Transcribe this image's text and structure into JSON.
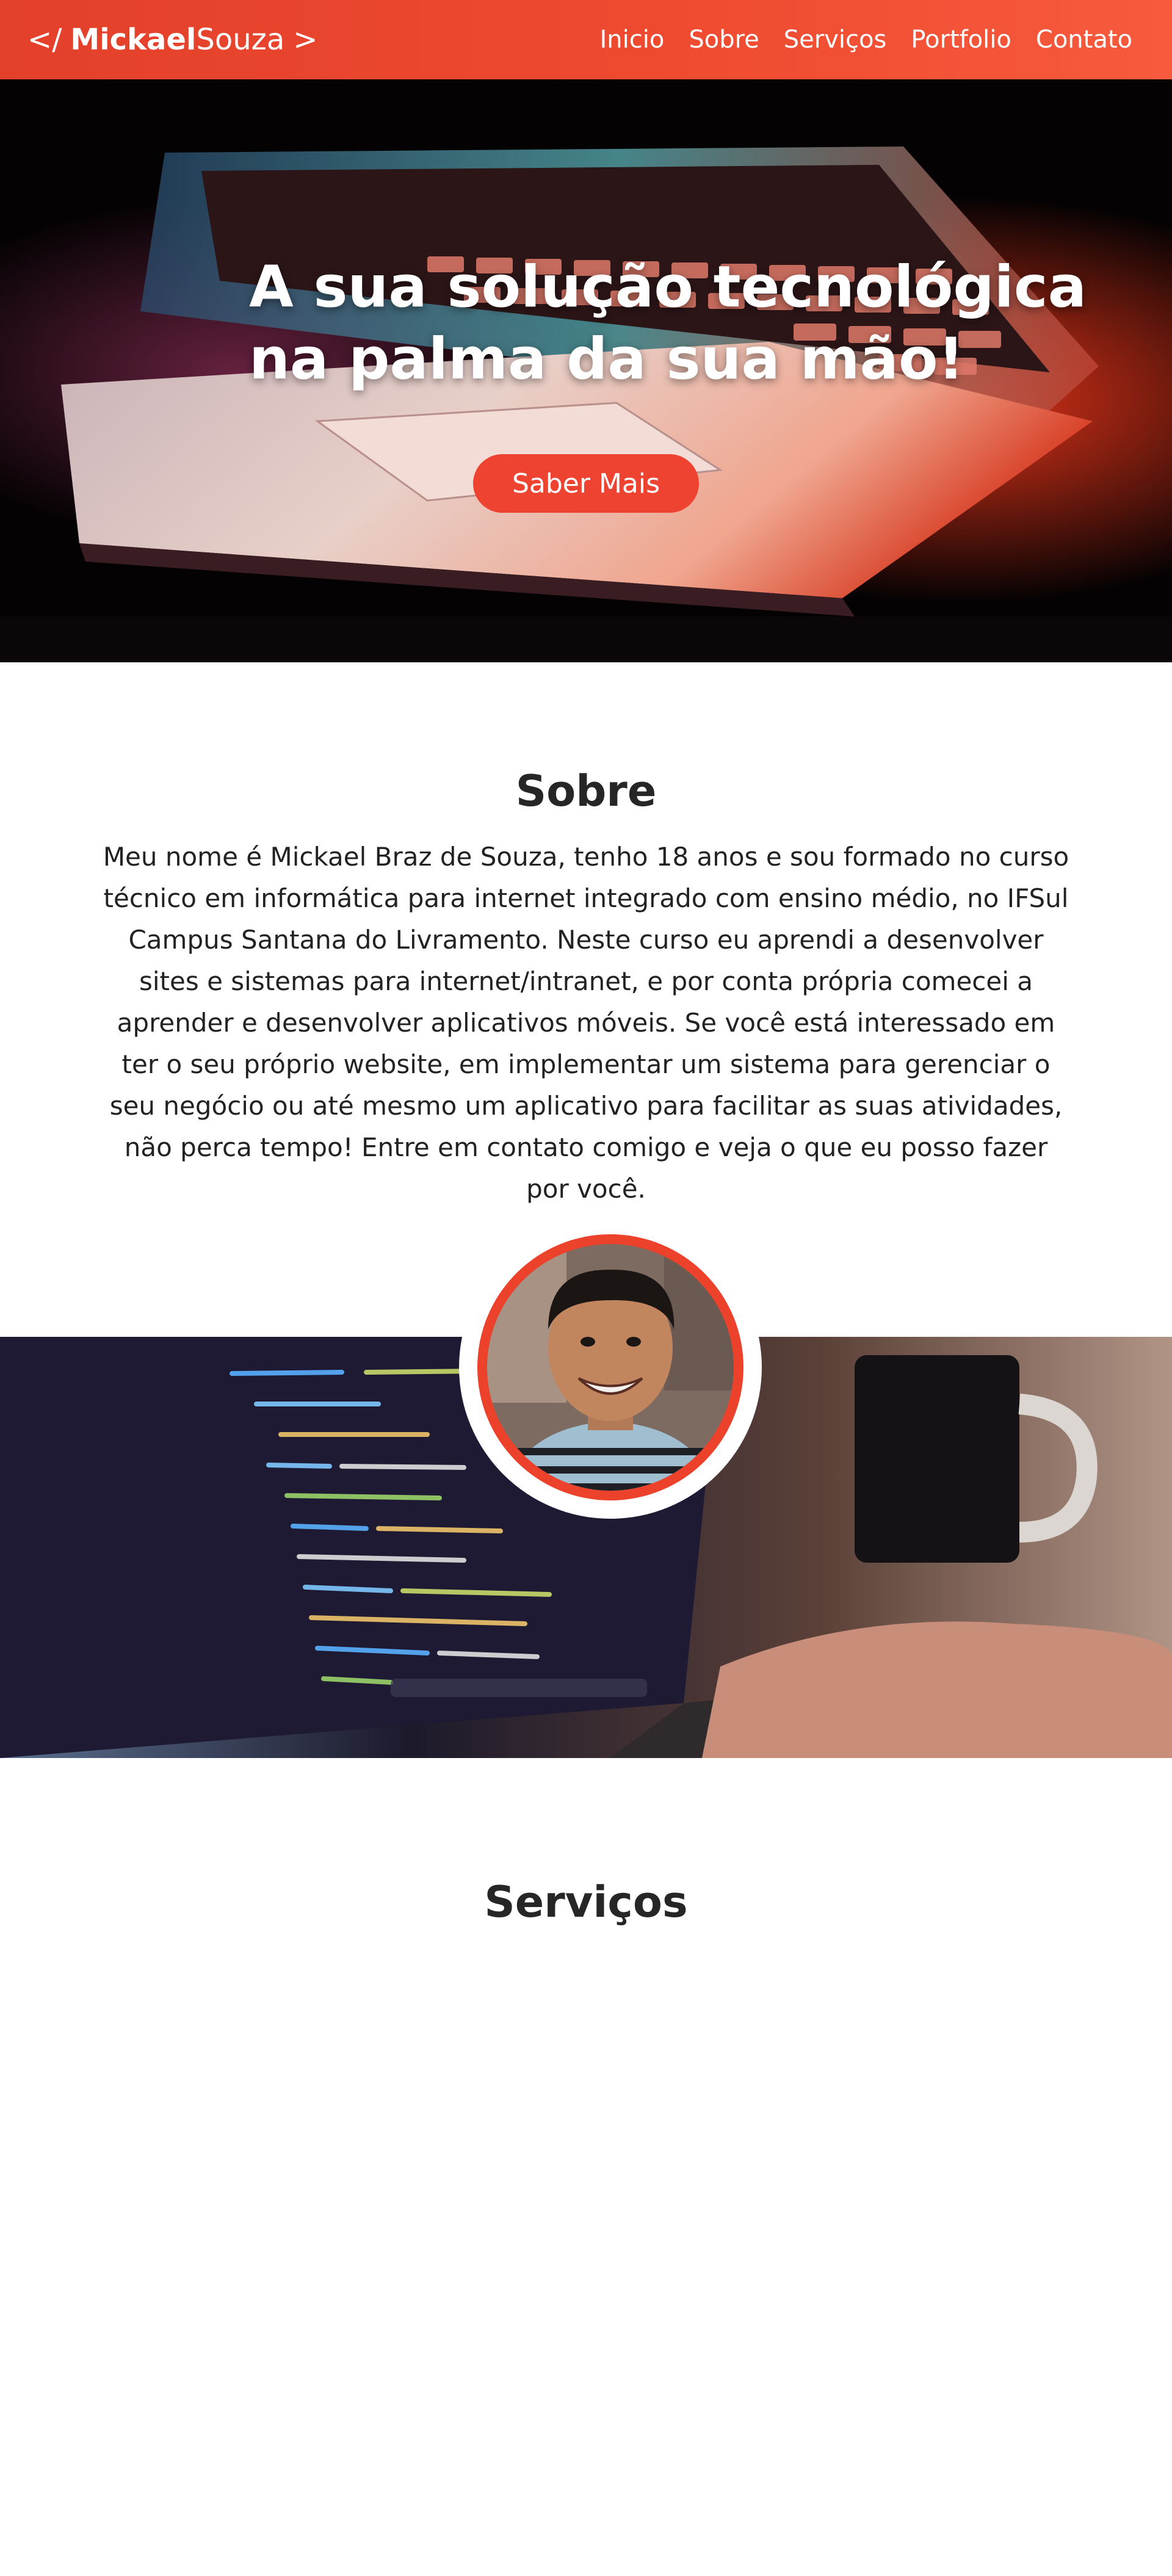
{
  "header": {
    "brand": {
      "prefix": "</",
      "first": "Mickael",
      "last": "Souza",
      "suffix": ">"
    },
    "nav": [
      {
        "label": "Inicio"
      },
      {
        "label": "Sobre"
      },
      {
        "label": "Serviços"
      },
      {
        "label": "Portfolio"
      },
      {
        "label": "Contato"
      }
    ],
    "colors": {
      "accent": "#ee4330",
      "gradient_end": "#f75a3d"
    }
  },
  "hero": {
    "title_line1": "A sua solução tecnológica",
    "title_line2": "na palma da sua mão!",
    "cta_label": "Saber Mais"
  },
  "sobre": {
    "title": "Sobre",
    "text": "Meu nome é Mickael Braz de Souza, tenho 18 anos e sou formado no curso técnico em informática para internet integrado com ensino médio, no IFSul Campus Santana do Livramento. Neste curso eu aprendi a desenvolver sites e sistemas para internet/intranet, e por conta própria comecei a aprender e desenvolver aplicativos móveis. Se você está interessado em ter o seu próprio website, em implementar um sistema para gerenciar o seu negócio ou até mesmo um aplicativo para facilitar as suas atividades, não perca tempo!  Entre em contato comigo e veja o que eu posso fazer por você."
  },
  "servicos": {
    "title": "Serviços"
  }
}
